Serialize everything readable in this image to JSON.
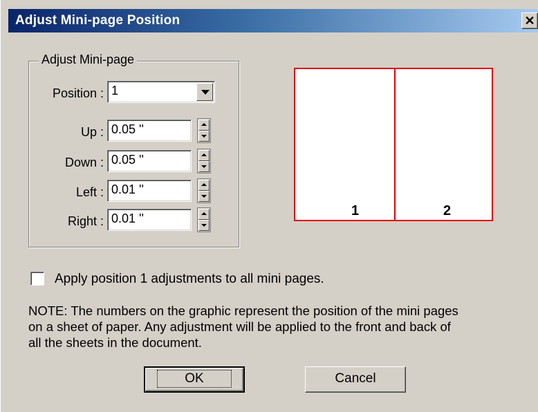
{
  "window": {
    "title": "Adjust Mini-page Position",
    "close_glyph": "✕"
  },
  "group": {
    "legend": "Adjust Mini-page",
    "position_label": "Position :",
    "position_value": "1",
    "up_label": "Up :",
    "up_value": "0.05 ''",
    "down_label": "Down :",
    "down_value": "0.05 ''",
    "left_label": "Left :",
    "left_value": "0.01 ''",
    "right_label": "Right :",
    "right_value": "0.01 ''"
  },
  "preview": {
    "page1": "1",
    "page2": "2"
  },
  "apply_all": {
    "label": "Apply position 1 adjustments to all mini pages.",
    "checked": false
  },
  "note": "NOTE: The numbers on the graphic represent the position of the mini pages\non a sheet of paper.  Any adjustment will be applied to the front and back of\nall the sheets in the document.",
  "buttons": {
    "ok": "OK",
    "cancel": "Cancel"
  }
}
